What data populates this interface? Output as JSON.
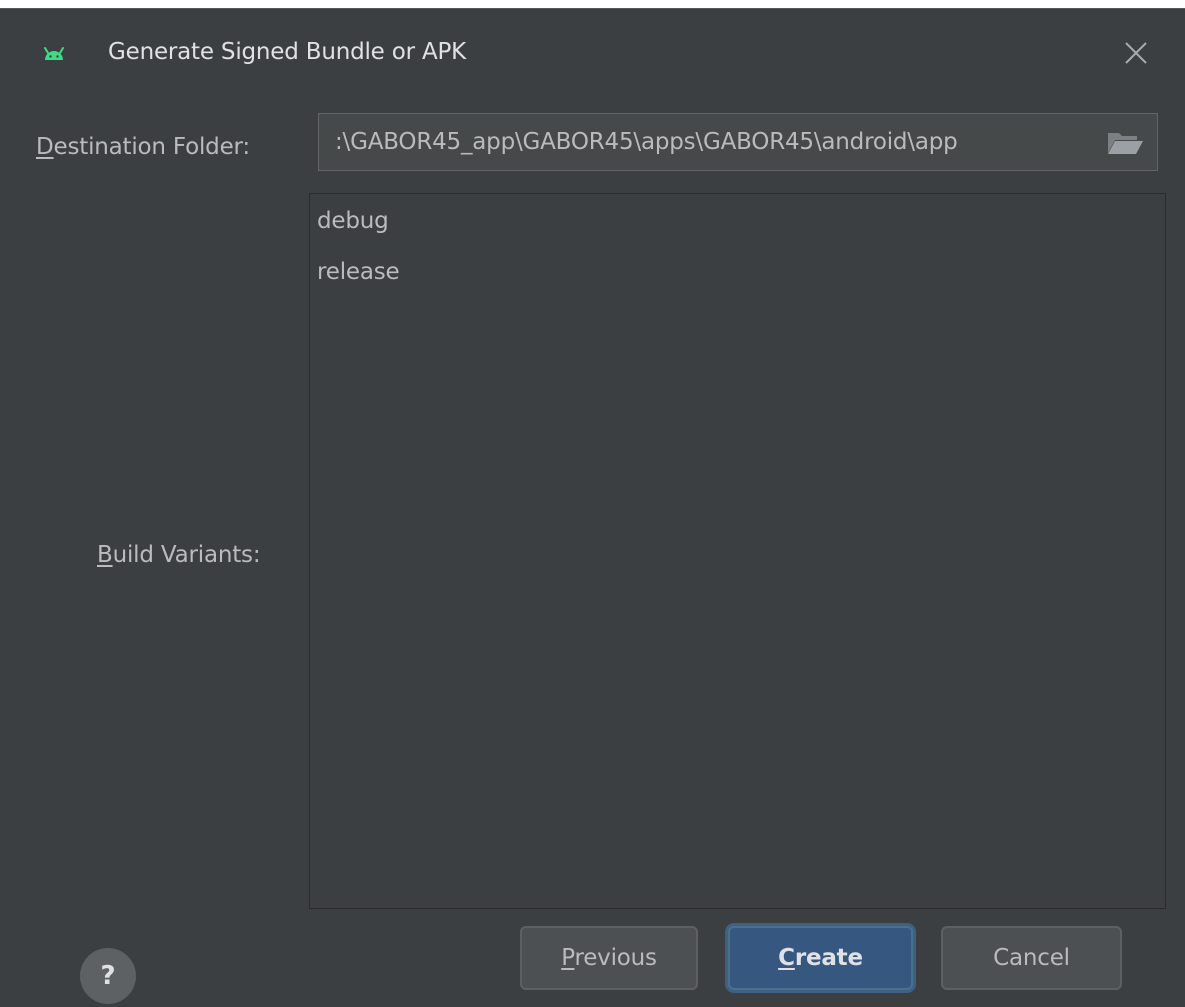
{
  "dialog": {
    "title": "Generate Signed Bundle or APK",
    "close_icon": "close-icon",
    "app_icon": "android-icon"
  },
  "form": {
    "destination": {
      "label_mnemonic": "D",
      "label_rest": "estination Folder:",
      "value": ":\\GABOR45_app\\GABOR45\\apps\\GABOR45\\android\\app",
      "folder_icon": "folder-open-icon"
    },
    "variants": {
      "label_mnemonic": "B",
      "label_rest": "uild Variants:",
      "items": [
        {
          "label": "debug"
        },
        {
          "label": "release"
        }
      ]
    }
  },
  "footer": {
    "help_label": "?",
    "previous": {
      "mnemonic": "P",
      "rest": "revious"
    },
    "create": {
      "mnemonic": "C",
      "rest": "reate"
    },
    "cancel_label": "Cancel"
  },
  "colors": {
    "background": "#3c3f41",
    "primary_button": "#365880",
    "android_green": "#3ddc84"
  }
}
